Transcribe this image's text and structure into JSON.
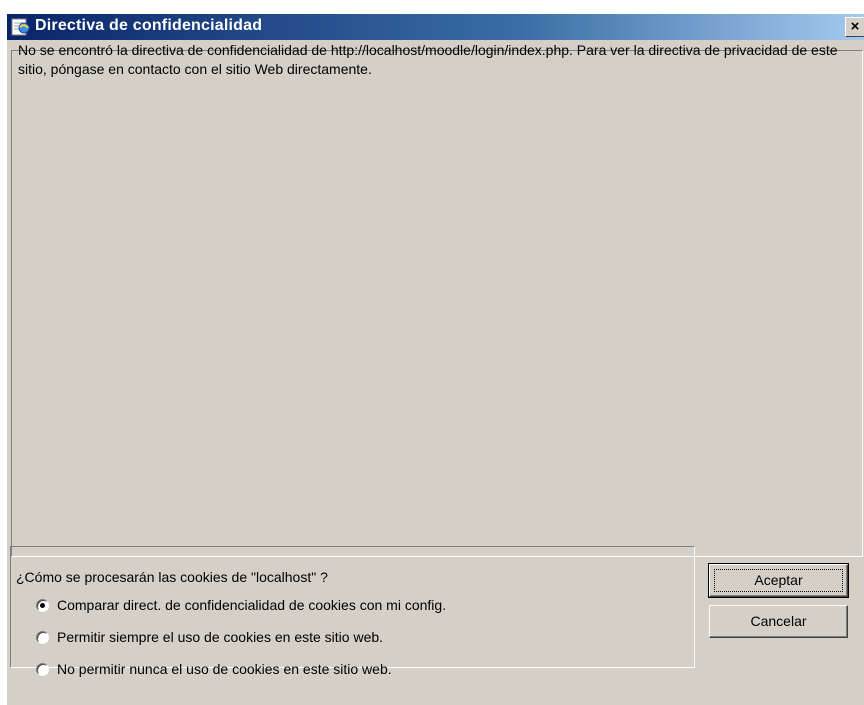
{
  "window": {
    "title": "Directiva de confidencialidad",
    "close_label": "×"
  },
  "content": {
    "message": "No se encontró la directiva de confidencialidad de http://localhost/moodle/login/index.php. Para ver la directiva de privacidad de este sitio, póngase en contacto con el sitio Web directamente."
  },
  "cookies": {
    "question": "¿Cómo se procesarán las cookies de \"localhost\" ?",
    "options": [
      {
        "label": "Comparar direct. de confidencialidad de cookies con mi config.",
        "selected": true
      },
      {
        "label": "Permitir siempre el uso de cookies en este sitio web.",
        "selected": false
      },
      {
        "label": "No permitir nunca el uso de cookies en este sitio web.",
        "selected": false
      }
    ]
  },
  "buttons": {
    "accept": "Aceptar",
    "cancel": "Cancelar"
  },
  "icons": {
    "title": "ie-globe-icon",
    "close": "close-icon"
  }
}
